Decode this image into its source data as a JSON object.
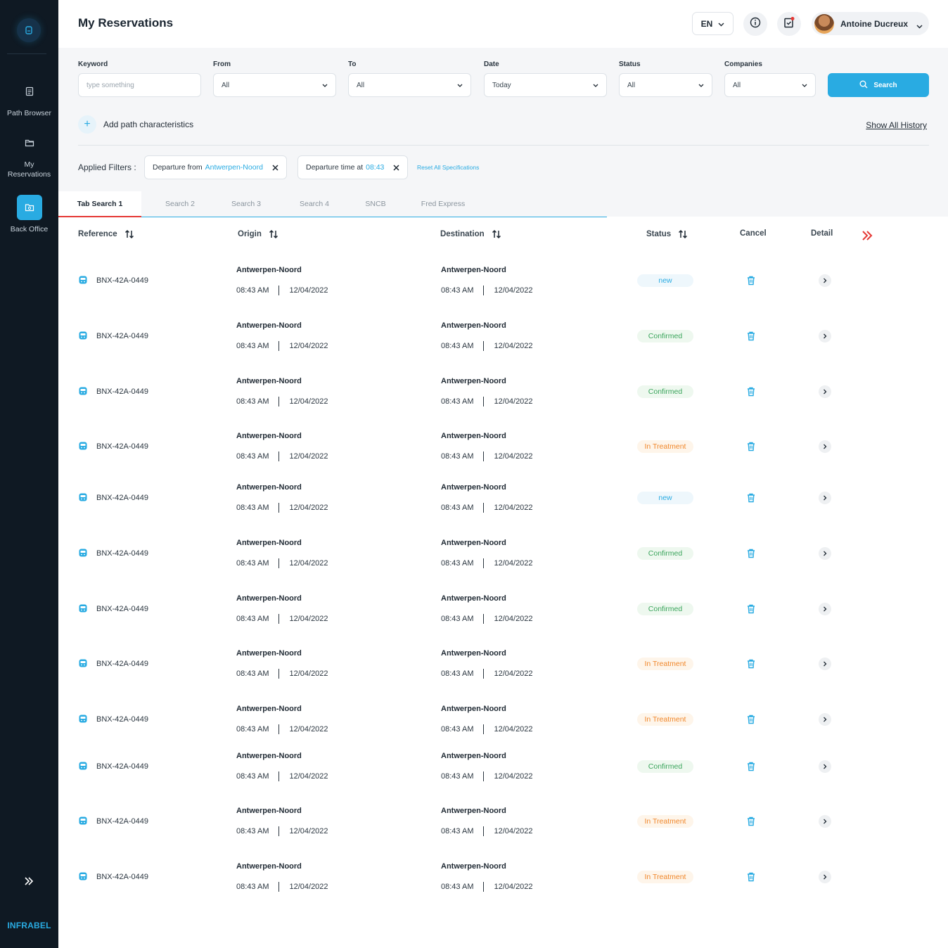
{
  "app": {
    "brand": "INFRABEL",
    "page_title": "My Reservations"
  },
  "sidebar": {
    "items": [
      {
        "label": "Path Browser",
        "icon": "document-icon"
      },
      {
        "label": "My Reservations",
        "icon": "folder-icon"
      },
      {
        "label": "Back Office",
        "icon": "back-office-icon",
        "active": true
      }
    ]
  },
  "header": {
    "language": "EN",
    "user_name": "Antoine Ducreux",
    "notification_badge_color": "#e53935"
  },
  "filters": {
    "keyword": {
      "label": "Keyword",
      "placeholder": "type something",
      "value": ""
    },
    "from": {
      "label": "From",
      "value": "All"
    },
    "to": {
      "label": "To",
      "value": "All"
    },
    "date": {
      "label": "Date",
      "value": "Today"
    },
    "status": {
      "label": "Status",
      "value": "All"
    },
    "companies": {
      "label": "Companies",
      "value": "All"
    },
    "search_label": "Search",
    "add_path_label": "Add path characteristics",
    "show_history_label": "Show All History",
    "applied_label": "Applied Filters :",
    "applied": [
      {
        "prefix": "Departure from",
        "value": "Antwerpen-Noord"
      },
      {
        "prefix": "Departure time at",
        "value": "08:43"
      }
    ],
    "reset_label": "Reset All Specifications"
  },
  "tabs": [
    {
      "label": "Tab Search 1",
      "active": true
    },
    {
      "label": "Search 2"
    },
    {
      "label": "Search 3"
    },
    {
      "label": "Search 4"
    },
    {
      "label": "SNCB"
    },
    {
      "label": "Fred Express"
    }
  ],
  "table": {
    "columns": {
      "reference": "Reference",
      "origin": "Origin",
      "destination": "Destination",
      "status": "Status",
      "cancel": "Cancel",
      "detail": "Detail"
    },
    "rows": [
      {
        "reference": "BNX-42A-0449",
        "origin": "Antwerpen-Noord",
        "origin_time": "08:43 AM",
        "origin_date": "12/04/2022",
        "destination": "Antwerpen-Noord",
        "destination_time": "08:43 AM",
        "destination_date": "12/04/2022",
        "status": "new",
        "status_kind": "new"
      },
      {
        "reference": "BNX-42A-0449",
        "origin": "Antwerpen-Noord",
        "origin_time": "08:43 AM",
        "origin_date": "12/04/2022",
        "destination": "Antwerpen-Noord",
        "destination_time": "08:43 AM",
        "destination_date": "12/04/2022",
        "status": "Confirmed",
        "status_kind": "confirmed"
      },
      {
        "reference": "BNX-42A-0449",
        "origin": "Antwerpen-Noord",
        "origin_time": "08:43 AM",
        "origin_date": "12/04/2022",
        "destination": "Antwerpen-Noord",
        "destination_time": "08:43 AM",
        "destination_date": "12/04/2022",
        "status": "Confirmed",
        "status_kind": "confirmed"
      },
      {
        "reference": "BNX-42A-0449",
        "origin": "Antwerpen-Noord",
        "origin_time": "08:43 AM",
        "origin_date": "12/04/2022",
        "destination": "Antwerpen-Noord",
        "destination_time": "08:43 AM",
        "destination_date": "12/04/2022",
        "status": "In Treatment",
        "status_kind": "treatment"
      },
      {
        "reference": "BNX-42A-0449",
        "origin": "Antwerpen-Noord",
        "origin_time": "08:43 AM",
        "origin_date": "12/04/2022",
        "destination": "Antwerpen-Noord",
        "destination_time": "08:43 AM",
        "destination_date": "12/04/2022",
        "status": "new",
        "status_kind": "new"
      },
      {
        "reference": "BNX-42A-0449",
        "origin": "Antwerpen-Noord",
        "origin_time": "08:43 AM",
        "origin_date": "12/04/2022",
        "destination": "Antwerpen-Noord",
        "destination_time": "08:43 AM",
        "destination_date": "12/04/2022",
        "status": "Confirmed",
        "status_kind": "confirmed"
      },
      {
        "reference": "BNX-42A-0449",
        "origin": "Antwerpen-Noord",
        "origin_time": "08:43 AM",
        "origin_date": "12/04/2022",
        "destination": "Antwerpen-Noord",
        "destination_time": "08:43 AM",
        "destination_date": "12/04/2022",
        "status": "Confirmed",
        "status_kind": "confirmed"
      },
      {
        "reference": "BNX-42A-0449",
        "origin": "Antwerpen-Noord",
        "origin_time": "08:43 AM",
        "origin_date": "12/04/2022",
        "destination": "Antwerpen-Noord",
        "destination_time": "08:43 AM",
        "destination_date": "12/04/2022",
        "status": "In Treatment",
        "status_kind": "treatment"
      },
      {
        "reference": "BNX-42A-0449",
        "origin": "Antwerpen-Noord",
        "origin_time": "08:43 AM",
        "origin_date": "12/04/2022",
        "destination": "Antwerpen-Noord",
        "destination_time": "08:43 AM",
        "destination_date": "12/04/2022",
        "status": "In Treatment",
        "status_kind": "treatment"
      },
      {
        "reference": "BNX-42A-0449",
        "origin": "Antwerpen-Noord",
        "origin_time": "08:43 AM",
        "origin_date": "12/04/2022",
        "destination": "Antwerpen-Noord",
        "destination_time": "08:43 AM",
        "destination_date": "12/04/2022",
        "status": "Confirmed",
        "status_kind": "confirmed"
      },
      {
        "reference": "BNX-42A-0449",
        "origin": "Antwerpen-Noord",
        "origin_time": "08:43 AM",
        "origin_date": "12/04/2022",
        "destination": "Antwerpen-Noord",
        "destination_time": "08:43 AM",
        "destination_date": "12/04/2022",
        "status": "In Treatment",
        "status_kind": "treatment"
      },
      {
        "reference": "BNX-42A-0449",
        "origin": "Antwerpen-Noord",
        "origin_time": "08:43 AM",
        "origin_date": "12/04/2022",
        "destination": "Antwerpen-Noord",
        "destination_time": "08:43 AM",
        "destination_date": "12/04/2022",
        "status": "In Treatment",
        "status_kind": "treatment"
      }
    ]
  },
  "colors": {
    "accent": "#29abe2",
    "sidebar_bg": "#0f1923",
    "active_tab_underline": "#e53935",
    "confirmed": "#3ba55c",
    "treatment": "#f0872b"
  }
}
